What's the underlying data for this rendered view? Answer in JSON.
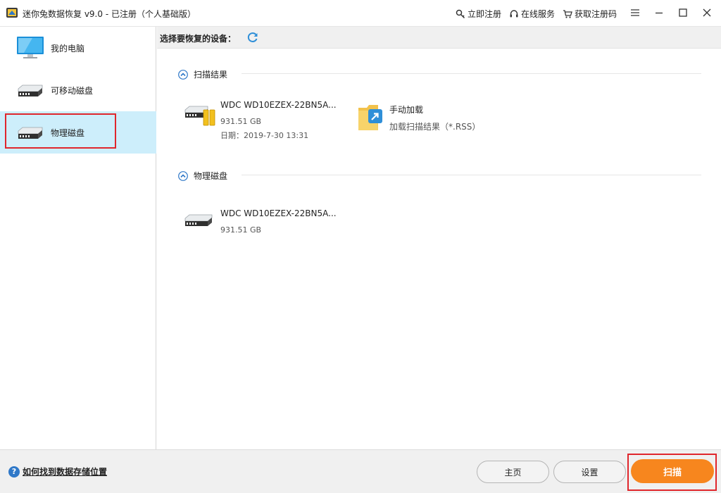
{
  "title": {
    "text": "迷你兔数据恢复 v9.0 - 已注册（个人基础版）"
  },
  "top_links": {
    "register_now": "立即注册",
    "online_service": "在线服务",
    "get_code": "获取注册码"
  },
  "sidebar": {
    "items": [
      {
        "label": "我的电脑",
        "icon": "monitor-icon"
      },
      {
        "label": "可移动磁盘",
        "icon": "drive-icon"
      },
      {
        "label": "物理磁盘",
        "icon": "drive-icon"
      }
    ]
  },
  "main": {
    "header_label": "选择要恢复的设备：",
    "sections": [
      {
        "title": "扫描结果",
        "devices": [
          {
            "name": "WDC WD10EZEX-22BN5A...",
            "size": "931.51 GB",
            "date": "日期：2019-7-30 13:31"
          }
        ],
        "manual": {
          "name": "手动加载",
          "desc": "加载扫描结果（*.RSS）"
        }
      },
      {
        "title": "物理磁盘",
        "devices": [
          {
            "name": "WDC WD10EZEX-22BN5A...",
            "size": "931.51 GB"
          }
        ]
      }
    ]
  },
  "footer": {
    "help": "如何找到数据存储位置",
    "home": "主页",
    "settings": "设置",
    "scan": "扫描"
  },
  "colors": {
    "accent": "#f7861e",
    "selection": "#cdeefb",
    "highlight_red": "#e0262c",
    "icon_blue": "#2f78c8"
  }
}
